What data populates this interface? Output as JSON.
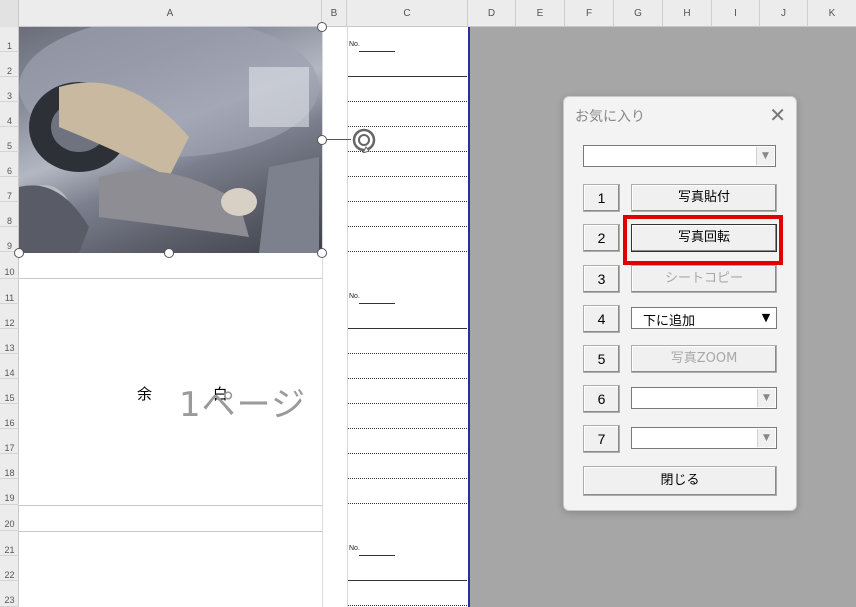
{
  "spreadsheet": {
    "columns": [
      "A",
      "B",
      "C",
      "D",
      "E",
      "F",
      "G",
      "H",
      "I",
      "J",
      "K"
    ],
    "rows": [
      "1",
      "2",
      "3",
      "4",
      "5",
      "6",
      "7",
      "8",
      "9",
      "10",
      "11",
      "12",
      "13",
      "14",
      "15",
      "16",
      "17",
      "18",
      "19",
      "20",
      "21",
      "22",
      "23"
    ],
    "no_label": "No.",
    "yohaku_text": "余 白",
    "page_text": "1ページ"
  },
  "dialog": {
    "title": "お気に入り",
    "close_glyph": "✕",
    "top_combo_value": "",
    "rows": [
      {
        "num": "1",
        "label": "写真貼付",
        "kind": "button",
        "enabled": true
      },
      {
        "num": "2",
        "label": "写真回転",
        "kind": "button",
        "enabled": true
      },
      {
        "num": "3",
        "label": "シートコピー",
        "kind": "button",
        "enabled": false
      },
      {
        "num": "4",
        "label": "下に追加",
        "kind": "combo",
        "enabled": true
      },
      {
        "num": "5",
        "label": "写真ZOOM",
        "kind": "button",
        "enabled": false
      },
      {
        "num": "6",
        "label": "",
        "kind": "combo",
        "enabled": false
      },
      {
        "num": "7",
        "label": "",
        "kind": "combo",
        "enabled": false
      }
    ],
    "close_button": "閉じる"
  },
  "colors": {
    "highlight": "#e00000",
    "print_boundary": "#2b2ba6"
  }
}
